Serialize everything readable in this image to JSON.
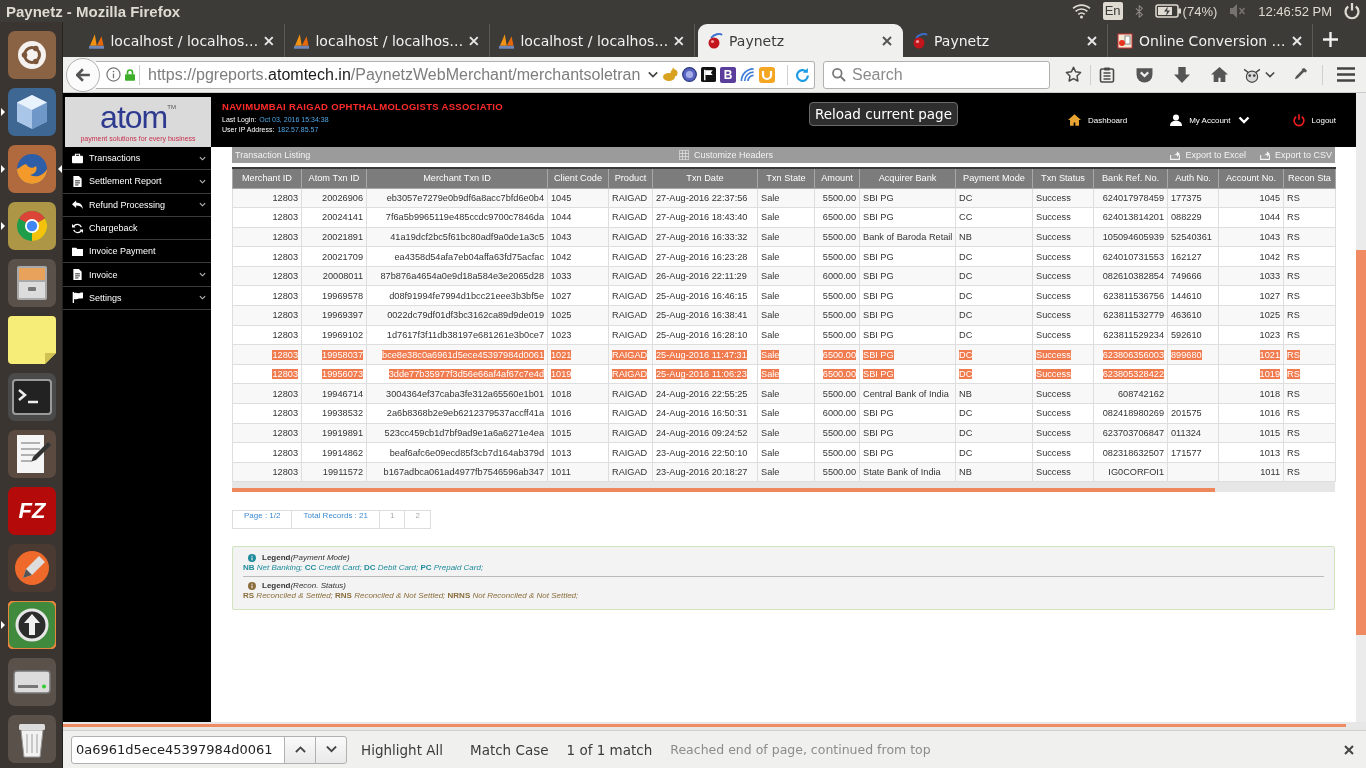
{
  "panel": {
    "title": "Paynetz - Mozilla Firefox",
    "keyboard": "En",
    "battery": "(74%)",
    "clock": "12:46:52 PM"
  },
  "launcher": [
    {
      "kind": "dash",
      "running": false,
      "selected": false
    },
    {
      "kind": "cube",
      "running": true,
      "selected": false
    },
    {
      "kind": "globe",
      "running": true,
      "selected": true
    },
    {
      "kind": "wheel",
      "running": true,
      "selected": false
    },
    {
      "kind": "drawer",
      "running": false,
      "selected": false
    },
    {
      "kind": "note",
      "running": false,
      "selected": false
    },
    {
      "kind": "terminal",
      "running": false,
      "selected": false
    },
    {
      "kind": "notepad",
      "running": false,
      "selected": false
    },
    {
      "kind": "letters",
      "text": "FZ",
      "running": false,
      "selected": false
    },
    {
      "kind": "pen",
      "running": false,
      "selected": false
    },
    {
      "kind": "updater",
      "running": true,
      "selected": false
    },
    {
      "kind": "drive",
      "running": false,
      "selected": false
    },
    {
      "kind": "trash",
      "running": false,
      "selected": false
    }
  ],
  "tabs": [
    {
      "kind": "sails",
      "title": "localhost / localhos…",
      "selected": false
    },
    {
      "kind": "sails",
      "title": "localhost / localhos…",
      "selected": false
    },
    {
      "kind": "sails",
      "title": "localhost / localhos…",
      "selected": false
    },
    {
      "kind": "ball",
      "title": "Paynetz",
      "selected": true
    },
    {
      "kind": "ball",
      "title": "Paynetz",
      "selected": false
    },
    {
      "kind": "document",
      "title": "Online Conversion …",
      "selected": false
    }
  ],
  "toolbar": {
    "url": "https://pgreports.**atomtech.in**/PaynetzWebMerchant/merchantsoletran",
    "extension_letter": "B",
    "search_placeholder": "Search"
  },
  "page": {
    "logo": {
      "wordmark": "atom$^{TM}$",
      "tagline": "payment solutions for every business"
    },
    "merchant_name": "NAVIMUMBAI RAIGAD OPHTHALMOLOGISTS ASSOCIATIO",
    "session": [
      {
        "label": "Last Login:",
        "value": "Oct 03, 2016 15:34:38"
      },
      {
        "label": "User IP Address:",
        "value": "182.57.85.57"
      }
    ],
    "tooltip": "Reload current page",
    "header_links": [
      {
        "kind": "home",
        "label": "Dashboard",
        "dropdown": false
      },
      {
        "kind": "user",
        "label": "My Account",
        "dropdown": true
      },
      {
        "kind": "power",
        "label": "Logout",
        "dropdown": false
      }
    ],
    "sidebar": [
      {
        "kind": "briefcase",
        "label": "Transactions",
        "expandable": true
      },
      {
        "kind": "document",
        "label": "Settlement Report",
        "expandable": true
      },
      {
        "kind": "reply",
        "label": "Refund Processing",
        "expandable": true
      },
      {
        "kind": "refresh",
        "label": "Chargeback",
        "expandable": false
      },
      {
        "kind": "folder",
        "label": "Invoice Payment",
        "expandable": false
      },
      {
        "kind": "document",
        "label": "Invoice",
        "expandable": true
      },
      {
        "kind": "flag",
        "label": "Settings",
        "expandable": true
      }
    ],
    "listing": {
      "title": "Transaction Listing",
      "actions": [
        {
          "kind": "grid",
          "label": "Customize Headers"
        },
        {
          "kind": "export",
          "label": "Export to Excel"
        },
        {
          "kind": "export",
          "label": "Export to CSV"
        }
      ]
    },
    "table": {
      "columns": [
        "Merchant ID",
        "Atom Txn ID",
        "Merchant Txn ID",
        "Client Code",
        "Product",
        "Txn Date",
        "Txn State",
        "Amount",
        "Acquirer Bank",
        "Payment Mode",
        "Txn Status",
        "Bank Ref. No.",
        "Auth No.",
        "Account No.",
        "Recon Sta"
      ],
      "rows": [
        {
          "selected": false,
          "cells": [
            "12803",
            "20026906",
            "eb3057e7279e0b9df6a8acc7bfd6e0b4",
            "1045",
            "RAIGAD",
            "27-Aug-2016 22:37:56",
            "Sale",
            "5500.00",
            "SBI PG",
            "DC",
            "Success",
            "624017978459",
            "177375",
            "1045",
            "RS"
          ]
        },
        {
          "selected": false,
          "cells": [
            "12803",
            "20024141",
            "7f6a5b9965119e485ccdc9700c7846da",
            "1044",
            "RAIGAD",
            "27-Aug-2016 18:43:40",
            "Sale",
            "6500.00",
            "SBI PG",
            "CC",
            "Success",
            "624013814201",
            "088229",
            "1044",
            "RS"
          ]
        },
        {
          "selected": false,
          "cells": [
            "12803",
            "20021891",
            "41a19dcf2bc5f61bc80adf9a0de1a3c5",
            "1043",
            "RAIGAD",
            "27-Aug-2016 16:33:32",
            "Sale",
            "5500.00",
            "Bank of Baroda Retail",
            "NB",
            "Success",
            "105094605939",
            "52540361",
            "1043",
            "RS"
          ]
        },
        {
          "selected": false,
          "cells": [
            "12803",
            "20021709",
            "ea4358d54afa7eb04affa63fd75acfac",
            "1042",
            "RAIGAD",
            "27-Aug-2016 16:23:28",
            "Sale",
            "5500.00",
            "SBI PG",
            "DC",
            "Success",
            "624010731553",
            "162127",
            "1042",
            "RS"
          ]
        },
        {
          "selected": false,
          "cells": [
            "12803",
            "20008011",
            "87b876a4654a0e9d18a584e3e2065d28",
            "1033",
            "RAIGAD",
            "26-Aug-2016 22:11:29",
            "Sale",
            "6000.00",
            "SBI PG",
            "DC",
            "Success",
            "082610382854",
            "749666",
            "1033",
            "RS"
          ]
        },
        {
          "selected": false,
          "cells": [
            "12803",
            "19969578",
            "d08f91994fe7994d1bcc21eee3b3bf5e",
            "1027",
            "RAIGAD",
            "25-Aug-2016 16:46:15",
            "Sale",
            "5500.00",
            "SBI PG",
            "DC",
            "Success",
            "623811536756",
            "144610",
            "1027",
            "RS"
          ]
        },
        {
          "selected": false,
          "cells": [
            "12803",
            "19969397",
            "0022dc79df01df3bc3162ca89d9de019",
            "1025",
            "RAIGAD",
            "25-Aug-2016 16:38:41",
            "Sale",
            "5500.00",
            "SBI PG",
            "DC",
            "Success",
            "623811532779",
            "463610",
            "1025",
            "RS"
          ]
        },
        {
          "selected": false,
          "cells": [
            "12803",
            "19969102",
            "1d7617f3f11db38197e681261e3b0ce7",
            "1023",
            "RAIGAD",
            "25-Aug-2016 16:28:10",
            "Sale",
            "5500.00",
            "SBI PG",
            "DC",
            "Success",
            "623811529234",
            "592610",
            "1023",
            "RS"
          ]
        },
        {
          "selected": true,
          "cells": [
            "12803",
            "19958037",
            "bce8e38c0a6961d5ece45397984d0061",
            "1021",
            "RAIGAD",
            "25-Aug-2016 11:47:31",
            "Sale",
            "6500.00",
            "SBI PG",
            "DC",
            "Success",
            "623806356003",
            "899680",
            "1021",
            "RS"
          ]
        },
        {
          "selected": true,
          "cells": [
            "12803",
            "19956073",
            "3dde77b35977f3d56e66af4af67c7e4d",
            "1019",
            "RAIGAD",
            "25-Aug-2016 11:06:23",
            "Sale",
            "6500.00",
            "SBI PG",
            "DC",
            "Success",
            "623805328422",
            null,
            "1019",
            "RS"
          ]
        },
        {
          "selected": false,
          "cells": [
            "12803",
            "19946714",
            "3004364ef37caba3fe312a65560e1b01",
            "1018",
            "RAIGAD",
            "24-Aug-2016 22:55:25",
            "Sale",
            "5500.00",
            "Central Bank of India",
            "NB",
            "Success",
            "608742162",
            null,
            "1018",
            "RS"
          ]
        },
        {
          "selected": false,
          "cells": [
            "12803",
            "19938532",
            "2a6b8368b2e9eb6212379537accff41a",
            "1016",
            "RAIGAD",
            "24-Aug-2016 16:50:31",
            "Sale",
            "6000.00",
            "SBI PG",
            "DC",
            "Success",
            "082418980269",
            "201575",
            "1016",
            "RS"
          ]
        },
        {
          "selected": false,
          "cells": [
            "12803",
            "19919891",
            "523cc459cb1d7bf9ad9e1a6a6271e4ea",
            "1015",
            "RAIGAD",
            "24-Aug-2016 09:24:52",
            "Sale",
            "5500.00",
            "SBI PG",
            "DC",
            "Success",
            "623703706847",
            "011324",
            "1015",
            "RS"
          ]
        },
        {
          "selected": false,
          "cells": [
            "12803",
            "19914862",
            "beaf6afc6e09ecd85f3cb7d164ab379d",
            "1013",
            "RAIGAD",
            "23-Aug-2016 22:50:10",
            "Sale",
            "5500.00",
            "SBI PG",
            "DC",
            "Success",
            "082318632507",
            "171577",
            "1013",
            "RS"
          ]
        },
        {
          "selected": false,
          "cells": [
            "12803",
            "19911572",
            "b167adbca061ad4977fb7546596ab347",
            "1011",
            "RAIGAD",
            "23-Aug-2016 20:18:27",
            "Sale",
            "5500.00",
            "State Bank of India",
            "NB",
            "Success",
            "IG0CORFOI1",
            null,
            "1011",
            "RS"
          ]
        }
      ]
    },
    "pagination": [
      {
        "kind": "info",
        "text": "Page : 1/2"
      },
      {
        "kind": "info",
        "text": "Total Records : 21"
      },
      {
        "kind": "page",
        "text": "1"
      },
      {
        "kind": "page",
        "text": "2"
      }
    ],
    "legend": [
      {
        "color": "#1f8c9c",
        "heading": "**Legend**(Payment Mode)",
        "text": "**NB** Net Banking; **CC** Credit Card; **DC** Debit Card; **PC** Prepaid Card;"
      },
      {
        "color": "#8a6d3b",
        "heading": "**Legend**(Recon. Status)",
        "text": "**RS** Reconciled & Settled; **RNS** Reconciled & Not Settled; **NRNS** Not Reconciled & Not Settled;"
      }
    ]
  },
  "find_bar": {
    "query": "0a6961d5ece45397984d0061",
    "options": [
      "Highlight All",
      "Match Case"
    ],
    "result": "1 of 1 match",
    "status": "Reached end of page, continued from top"
  }
}
